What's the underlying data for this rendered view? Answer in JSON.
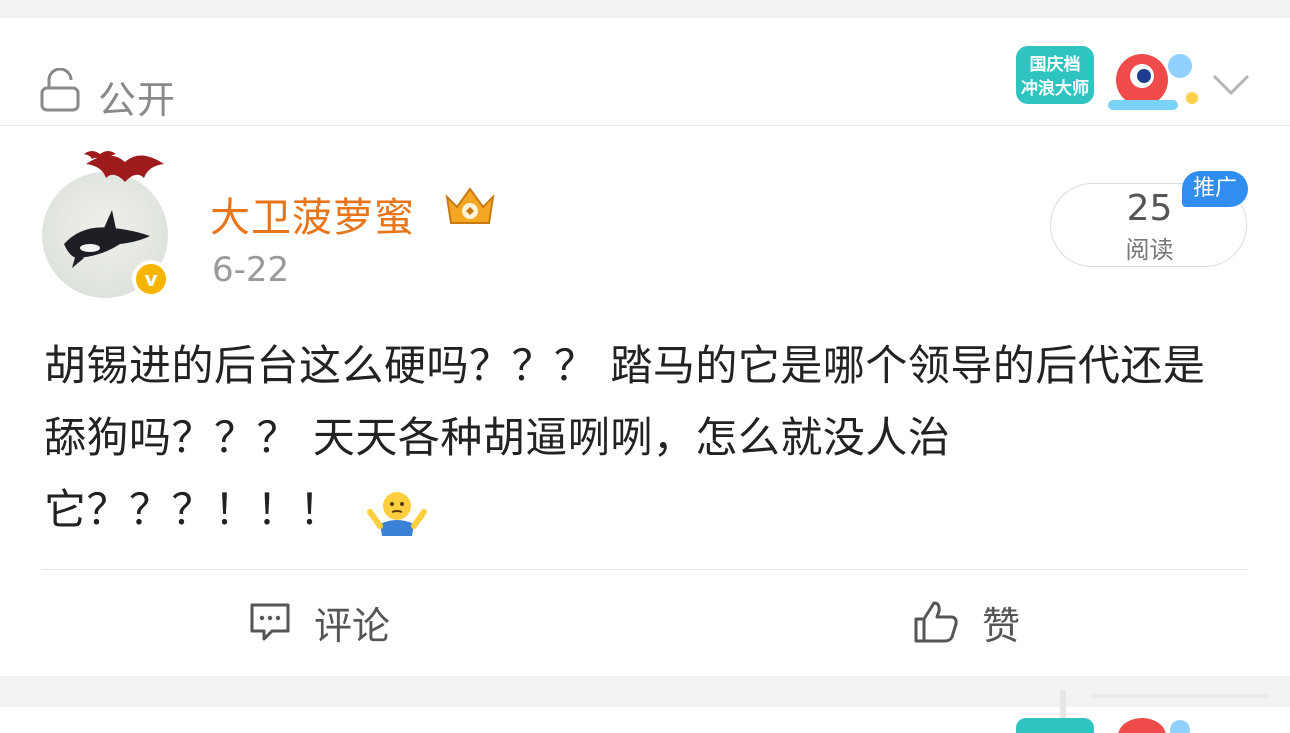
{
  "privacy": {
    "label": "公开"
  },
  "event_badge": {
    "line1": "国庆档",
    "line2": "冲浪大师"
  },
  "post": {
    "author": "大卫菠萝蜜",
    "date": "6-22",
    "reads": {
      "count": "25",
      "label": "阅读"
    },
    "promo_tag": "推广",
    "verified_mark": "v",
    "text": "胡锡进的后台这么硬吗？？？ 踏马的它是哪个领导的后代还是舔狗吗？？？ 天天各种胡逼咧咧，怎么就没人治它？？？！！！"
  },
  "actions": {
    "comment_label": "评论",
    "like_label": "赞"
  },
  "colors": {
    "author": "#e8751a",
    "promo": "#2f8ef0",
    "verified": "#f7b500"
  }
}
